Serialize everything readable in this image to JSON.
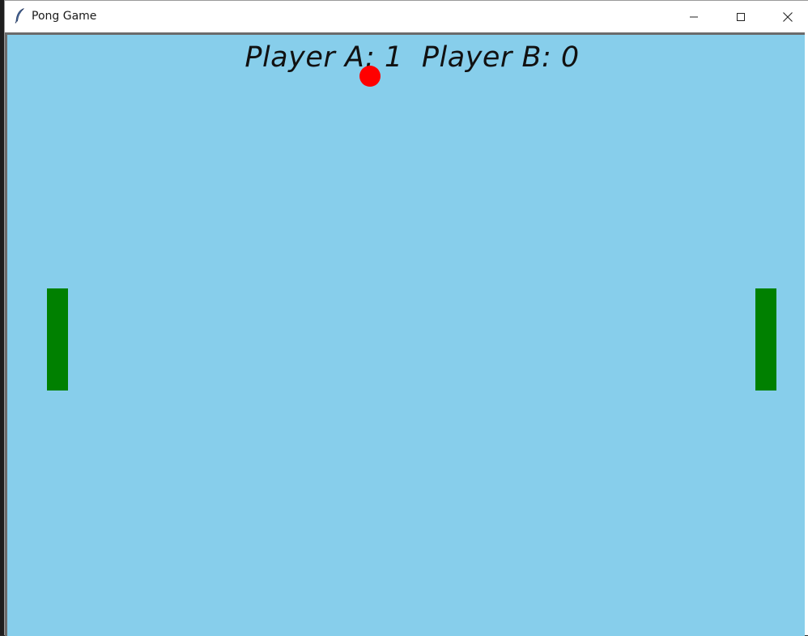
{
  "window": {
    "title": "Pong Game",
    "icon": "feather-icon",
    "controls": [
      "minimize-icon",
      "maximize-icon",
      "close-icon"
    ]
  },
  "game": {
    "score_text": "Player A: 1  Player B: 0",
    "player_a_score": 1,
    "player_b_score": 0,
    "colors": {
      "background": "#87ceeb",
      "ball": "#ff0000",
      "paddle": "#008000",
      "text": "#111111"
    }
  }
}
